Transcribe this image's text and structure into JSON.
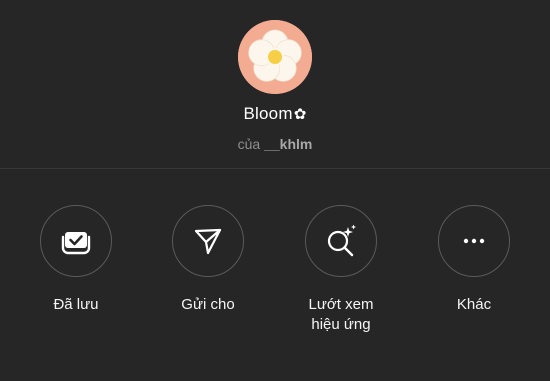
{
  "effect": {
    "name": "Bloom",
    "name_glyph": "✿",
    "by_prefix": "của",
    "author": "__khlm",
    "avatar_icon": "daisy-flower-icon",
    "avatar_bg": "#f3ab92"
  },
  "actions": [
    {
      "icon": "saved-bookmark-check-icon",
      "label": "Đã lưu"
    },
    {
      "icon": "paper-plane-send-icon",
      "label": "Gửi cho"
    },
    {
      "icon": "search-sparkle-icon",
      "label_line1": "Lướt xem",
      "label_line2": "hiệu ứng"
    },
    {
      "icon": "more-dots-icon",
      "label": "Khác"
    }
  ],
  "colors": {
    "background": "#262626",
    "divider": "#363636",
    "circle_border": "#5a5a5a",
    "text_primary": "#ffffff",
    "text_secondary": "#8e8e8e"
  }
}
